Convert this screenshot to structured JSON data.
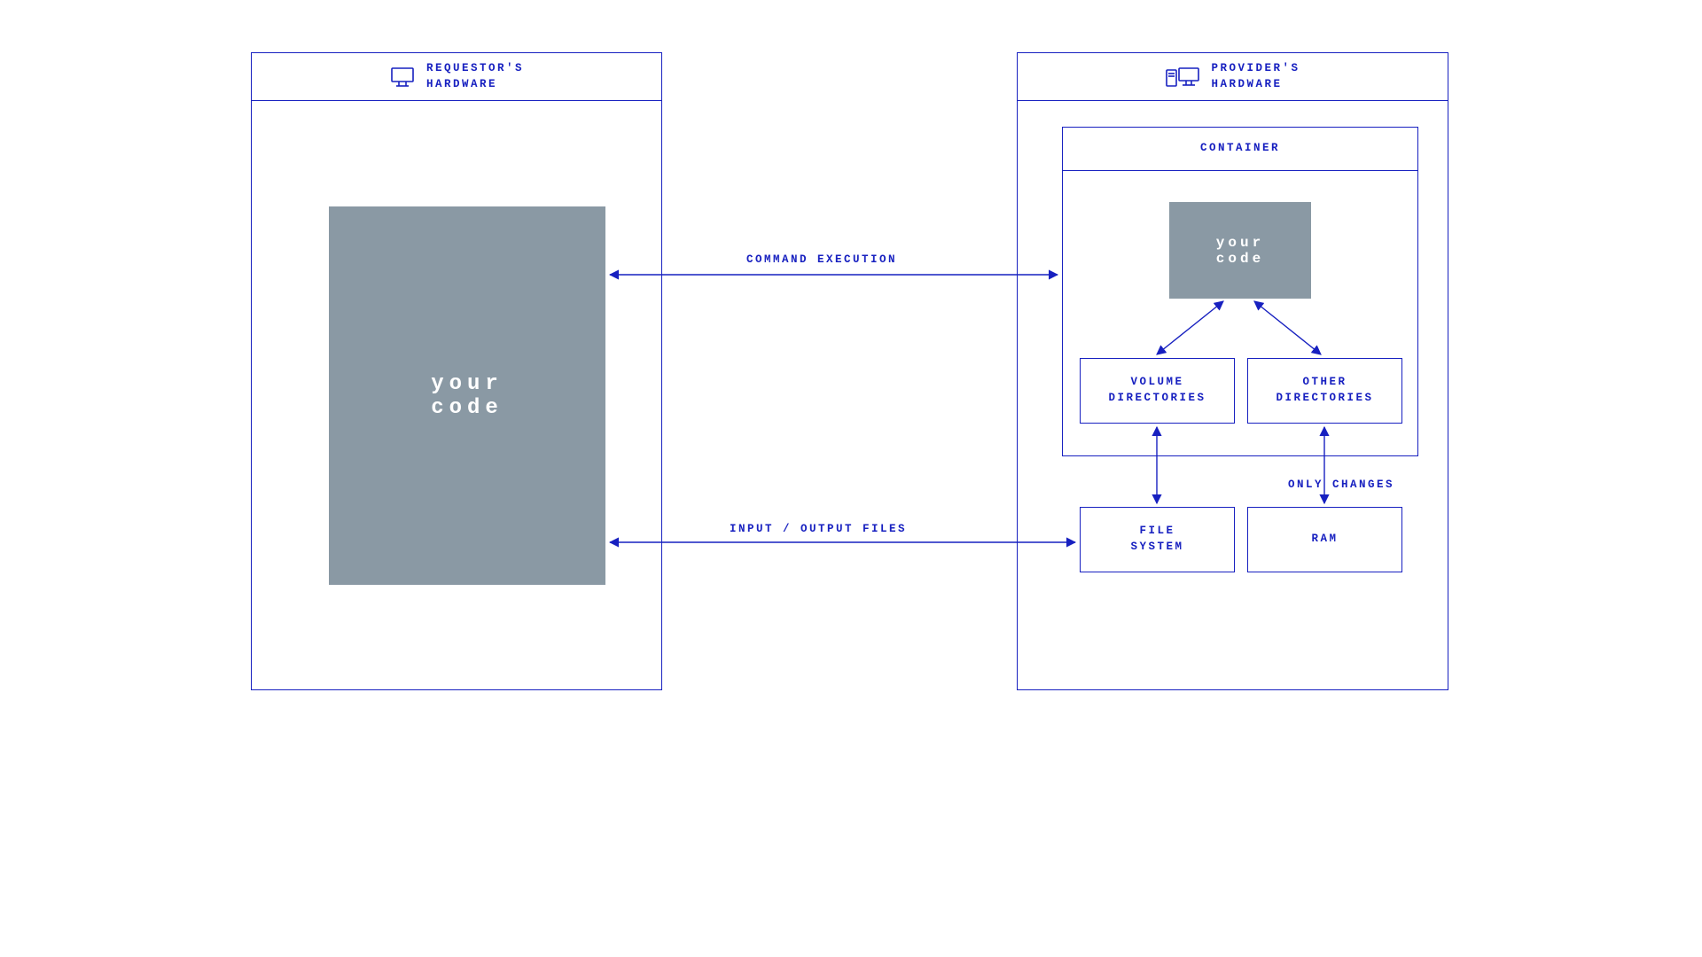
{
  "colors": {
    "primary": "#1720c0",
    "block": "#8a99a4"
  },
  "requestor": {
    "title_line1": "REQUESTOR'S",
    "title_line2": "HARDWARE",
    "code_block_line1": "your",
    "code_block_line2": "code"
  },
  "provider": {
    "title_line1": "PROVIDER'S",
    "title_line2": "HARDWARE",
    "container": {
      "title": "CONTAINER",
      "code_block_line1": "your",
      "code_block_line2": "code",
      "volume_line1": "VOLUME",
      "volume_line2": "DIRECTORIES",
      "other_line1": "OTHER",
      "other_line2": "DIRECTORIES"
    },
    "file_system_line1": "FILE",
    "file_system_line2": "SYSTEM",
    "ram": "RAM"
  },
  "arrows": {
    "command_execution": "COMMAND EXECUTION",
    "io_files": "INPUT / OUTPUT FILES",
    "only_changes": "ONLY CHANGES"
  }
}
